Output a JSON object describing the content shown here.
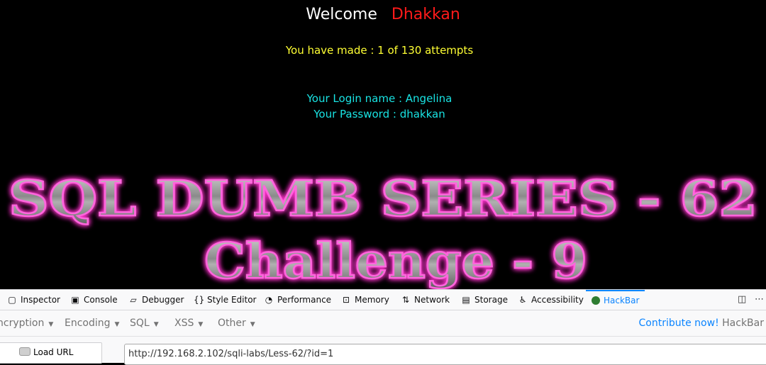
{
  "page": {
    "welcome_label": "Welcome",
    "username": "Dhakkan",
    "attempts_text": "You have made : 1 of 130 attempts",
    "login_line": "Your Login name : Angelina",
    "password_line": "Your Password : dhakkan",
    "banner_line1": "SQL DUMB SERIES - 62",
    "banner_line2": "Challenge - 9"
  },
  "devtools": {
    "tabs": [
      {
        "label": "Inspector",
        "icon": "inspector-icon"
      },
      {
        "label": "Console",
        "icon": "console-icon"
      },
      {
        "label": "Debugger",
        "icon": "debugger-icon"
      },
      {
        "label": "Style Editor",
        "icon": "style-editor-icon"
      },
      {
        "label": "Performance",
        "icon": "performance-icon"
      },
      {
        "label": "Memory",
        "icon": "memory-icon"
      },
      {
        "label": "Network",
        "icon": "network-icon"
      },
      {
        "label": "Storage",
        "icon": "storage-icon"
      },
      {
        "label": "Accessibility",
        "icon": "accessibility-icon"
      },
      {
        "label": "HackBar",
        "icon": "hackbar-icon",
        "active": true
      }
    ]
  },
  "hackbar": {
    "menu": [
      "ncryption",
      "Encoding",
      "SQL",
      "XSS",
      "Other"
    ],
    "contribute_link": "Contribute now!",
    "brand": "HackBar",
    "load_url_label": "Load URL",
    "url_value": "http://192.168.2.102/sqli-labs/Less-62/?id=1"
  },
  "colors": {
    "welcome": "#ffffff",
    "username": "#ff1a1a",
    "attempts": "#ffff33",
    "login": "#19e3e3",
    "banner_glow": "#ff33cc",
    "active_tab": "#0a84ff"
  }
}
